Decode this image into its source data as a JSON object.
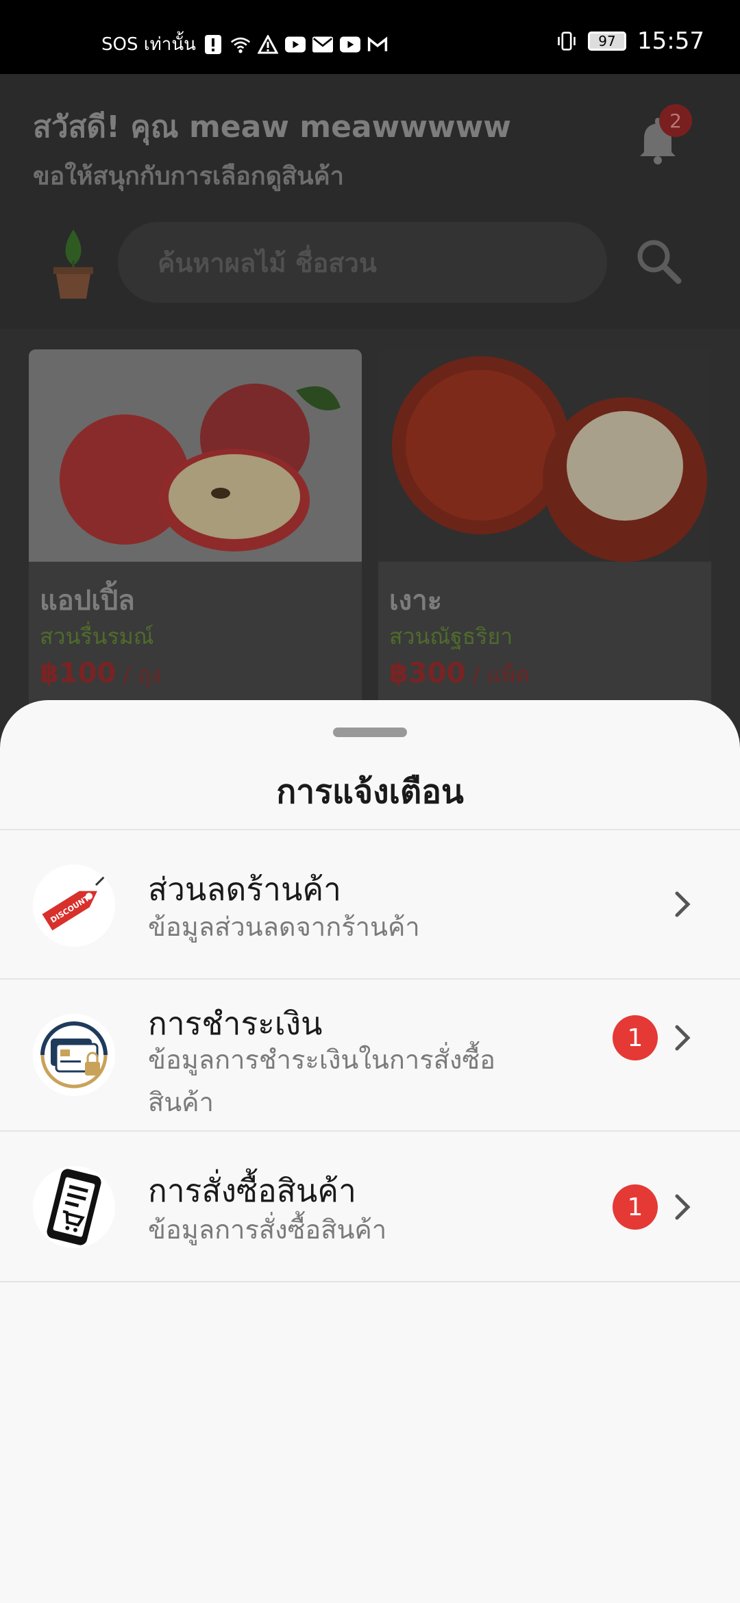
{
  "status_bar": {
    "carrier": "SOS เท่านั้น",
    "battery": "97",
    "time": "15:57"
  },
  "header": {
    "greeting": "สวัสดี! คุณ meaw meawwwww",
    "subtitle": "ขอให้สนุกกับการเลือกดูสินค้า",
    "notification_count": "2"
  },
  "search": {
    "placeholder": "ค้นหาผลไม้ ชื่อสวน"
  },
  "products": [
    {
      "name": "แอปเปิ้ล",
      "garden": "สวนรื่นรมณ์",
      "price": "฿100",
      "unit": " / ถุง"
    },
    {
      "name": "เงาะ",
      "garden": "สวนณัฐธริยา",
      "price": "฿300",
      "unit": " / แพ็ค"
    }
  ],
  "sheet": {
    "title": "การแจ้งเตือน",
    "items": [
      {
        "title": "ส่วนลดร้านค้า",
        "desc": "ข้อมูลส่วนลดจากร้านค้า",
        "badge": "",
        "icon": "discount-tag-icon"
      },
      {
        "title": "การชำระเงิน",
        "desc": "ข้อมูลการชำระเงินในการสั่งซื้อสินค้า",
        "badge": "1",
        "icon": "payment-card-icon"
      },
      {
        "title": "การสั่งซื้อสินค้า",
        "desc": "ข้อมูลการสั่งซื้อสินค้า",
        "badge": "1",
        "icon": "order-phone-icon"
      }
    ]
  },
  "colors": {
    "accent_red": "#e53935",
    "garden_green": "#4f6b2c"
  }
}
